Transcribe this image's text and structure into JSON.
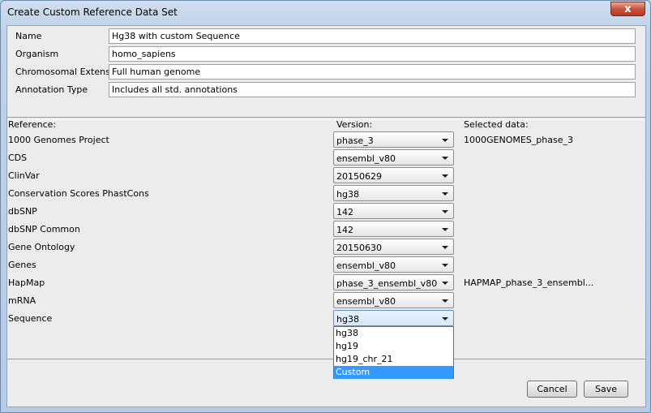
{
  "window": {
    "title": "Create Custom Reference Data Set",
    "close_label": "x"
  },
  "meta": [
    {
      "label": "Name",
      "value": "Hg38 with custom Sequence"
    },
    {
      "label": "Organism",
      "value": "homo_sapiens"
    },
    {
      "label": "Chromosomal Extension",
      "value": "Full human genome"
    },
    {
      "label": "Annotation Type",
      "value": "Includes all std. annotations"
    }
  ],
  "headers": {
    "reference": "Reference:",
    "version": "Version:",
    "selected": "Selected data:"
  },
  "references": [
    {
      "name": "1000 Genomes Project",
      "version": "phase_3",
      "selected": "1000GENOMES_phase_3"
    },
    {
      "name": "CDS",
      "version": "ensembl_v80",
      "selected": ""
    },
    {
      "name": "ClinVar",
      "version": "20150629",
      "selected": ""
    },
    {
      "name": "Conservation Scores PhastCons",
      "version": "hg38",
      "selected": ""
    },
    {
      "name": "dbSNP",
      "version": "142",
      "selected": ""
    },
    {
      "name": "dbSNP Common",
      "version": "142",
      "selected": ""
    },
    {
      "name": "Gene Ontology",
      "version": "20150630",
      "selected": ""
    },
    {
      "name": "Genes",
      "version": "ensembl_v80",
      "selected": ""
    },
    {
      "name": "HapMap",
      "version": "phase_3_ensembl_v80",
      "selected": "HAPMAP_phase_3_ensembl..."
    },
    {
      "name": "mRNA",
      "version": "ensembl_v80",
      "selected": ""
    },
    {
      "name": "Sequence",
      "version": "hg38",
      "selected": ""
    }
  ],
  "sequence_dropdown": {
    "options": [
      "hg38",
      "hg19",
      "hg19_chr_21",
      "Custom"
    ],
    "highlighted": "Custom"
  },
  "buttons": {
    "cancel": "Cancel",
    "save": "Save"
  }
}
